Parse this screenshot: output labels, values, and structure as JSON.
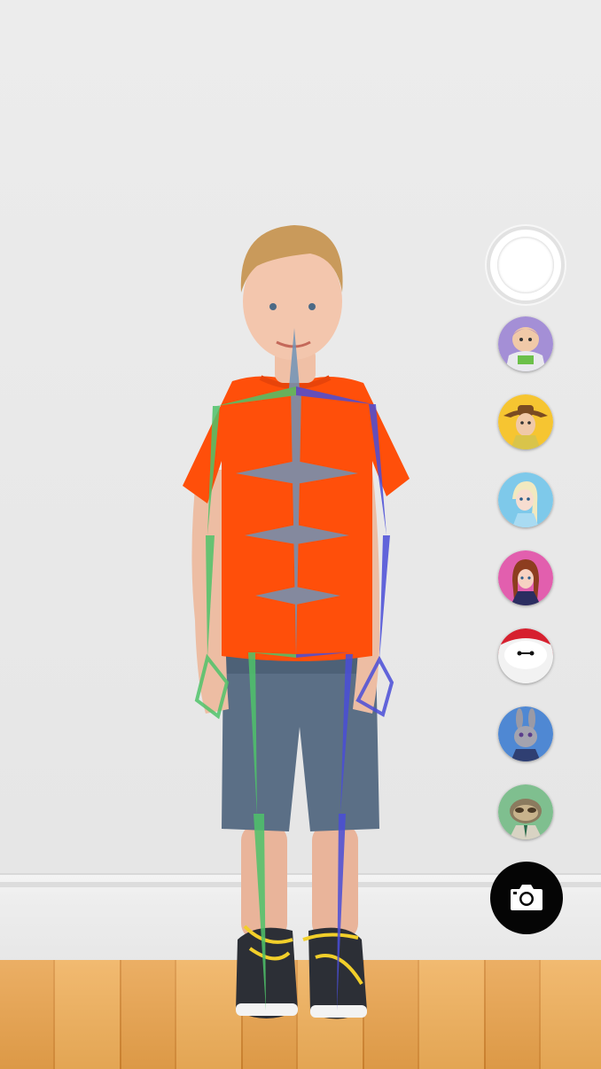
{
  "colors": {
    "wall": "#ebebeb",
    "floor": "#e8a14a",
    "skeleton_spine": "#6f94b8",
    "skeleton_left": "#4fc36a",
    "skeleton_right": "#4a4ed8",
    "camera_button": "#050505"
  },
  "sidebar": {
    "shutter": {
      "icon": "circle-shutter-icon"
    },
    "characters": [
      {
        "name": "buzz",
        "icon": "buzz-lightyear-avatar"
      },
      {
        "name": "woody",
        "icon": "woody-avatar"
      },
      {
        "name": "elsa",
        "icon": "elsa-avatar"
      },
      {
        "name": "anna",
        "icon": "anna-avatar"
      },
      {
        "name": "baymax",
        "icon": "baymax-avatar"
      },
      {
        "name": "judy",
        "icon": "judy-hopps-avatar"
      },
      {
        "name": "flash",
        "icon": "flash-sloth-avatar"
      }
    ],
    "capture": {
      "icon": "camera-icon"
    }
  }
}
